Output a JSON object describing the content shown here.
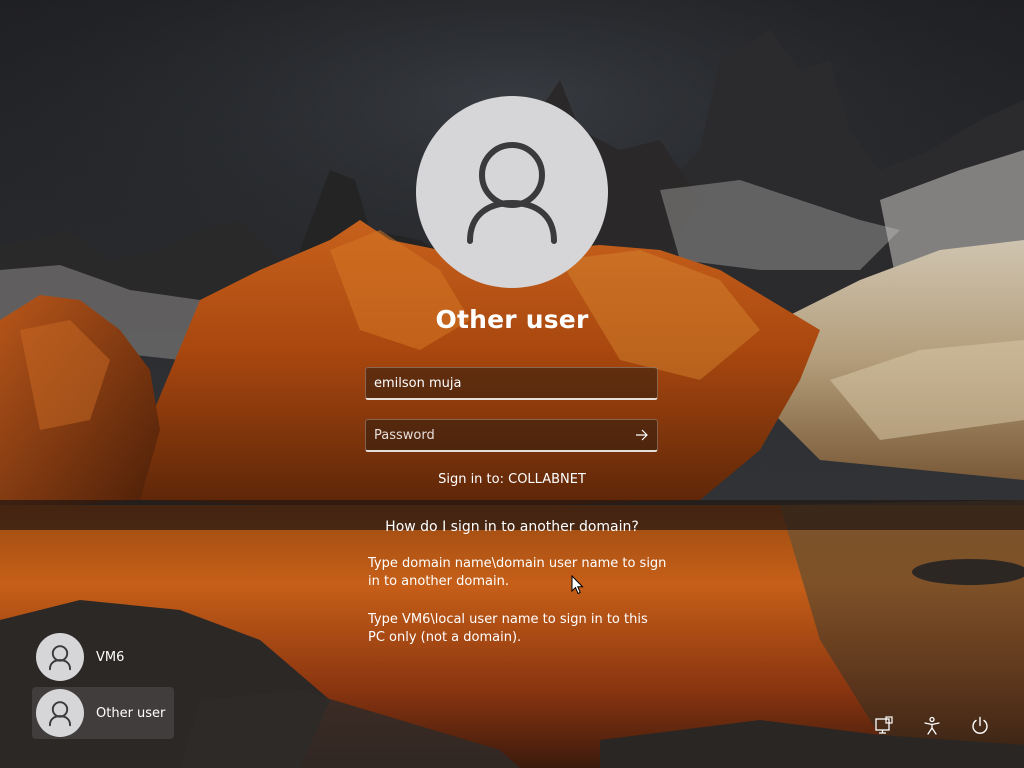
{
  "login": {
    "display_name": "Other user",
    "username_value": "emilson muja",
    "password_placeholder": "Password",
    "sign_in_to": "Sign in to: COLLABNET",
    "help_link": "How do I sign in to another domain?",
    "help_text_1": "Type domain name\\domain user name to sign in to another domain.",
    "help_text_2": "Type VM6\\local user name to sign in to this PC only (not a domain)."
  },
  "users": [
    {
      "label": "VM6",
      "icon": "user-icon",
      "selected": false
    },
    {
      "label": "Other user",
      "icon": "user-icon",
      "selected": true
    }
  ],
  "system_icons": [
    "network-icon",
    "accessibility-icon",
    "power-icon"
  ],
  "colors": {
    "avatar_bg": "#d6d5d8",
    "avatar_glyph": "#3a3a3c",
    "text": "#ffffff"
  }
}
